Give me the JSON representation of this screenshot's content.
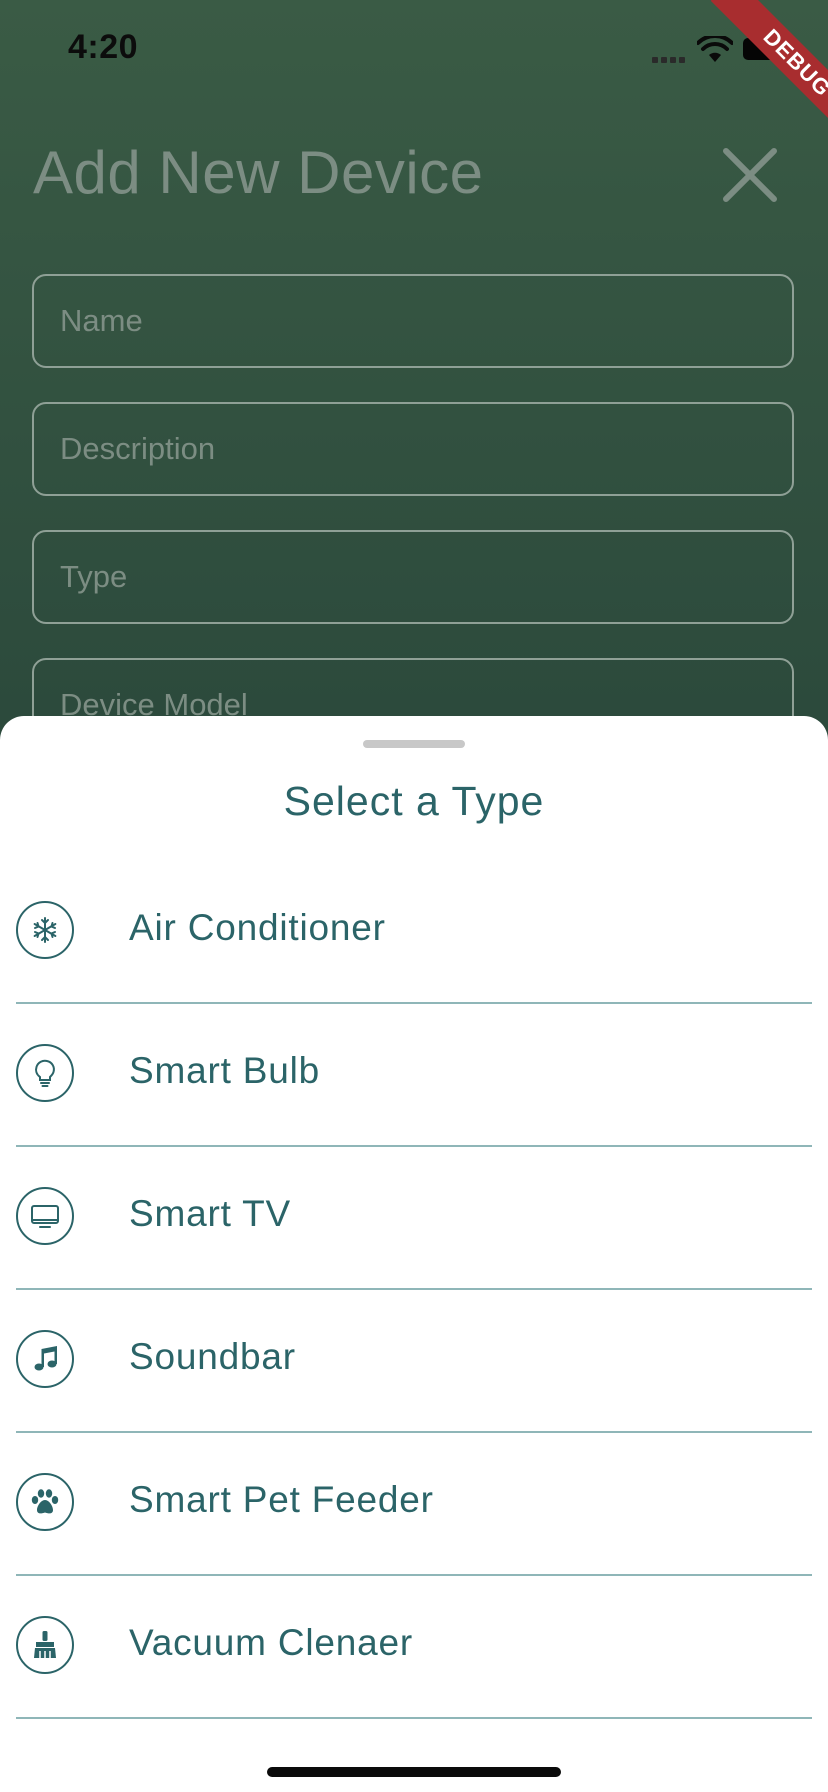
{
  "status_bar": {
    "time": "4:20"
  },
  "debug_banner": "DEBUG",
  "page": {
    "title": "Add New Device",
    "fields": [
      {
        "placeholder": "Name"
      },
      {
        "placeholder": "Description"
      },
      {
        "placeholder": "Type"
      },
      {
        "placeholder": "Device Model"
      }
    ]
  },
  "sheet": {
    "title": "Select a Type",
    "items": [
      {
        "label": "Air Conditioner",
        "icon": "snowflake-icon"
      },
      {
        "label": "Smart Bulb",
        "icon": "lightbulb-icon"
      },
      {
        "label": "Smart TV",
        "icon": "tv-icon"
      },
      {
        "label": "Soundbar",
        "icon": "music-note-icon"
      },
      {
        "label": "Smart Pet Feeder",
        "icon": "paw-icon"
      },
      {
        "label": "Vacuum Clenaer",
        "icon": "broom-icon"
      }
    ]
  },
  "colors": {
    "accent": "#2b6468",
    "divider": "#8fb6b8",
    "backdrop": "#2c4a3c",
    "debug_ribbon": "#a82d2f"
  }
}
